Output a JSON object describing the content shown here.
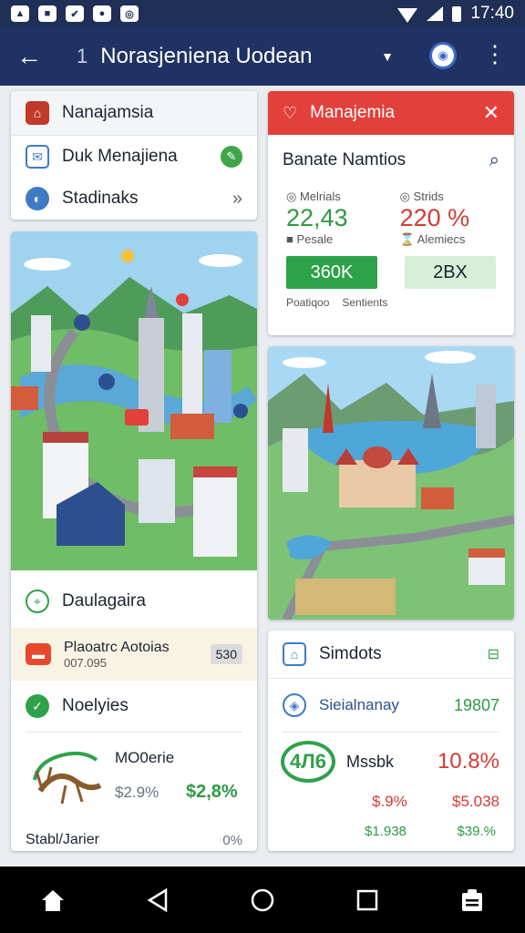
{
  "status": {
    "time": "17:40"
  },
  "appbar": {
    "number": "1",
    "title": "Norasjeniena Uodean"
  },
  "card1": {
    "header": "Nanajamsia",
    "items": [
      {
        "label": "Duk Menajiena"
      },
      {
        "label": "Stadinaks"
      }
    ]
  },
  "card2": {
    "header": "Manajemia",
    "title": "Banate Namtios",
    "metrics": [
      {
        "label": "Melrials",
        "value": "22,43",
        "sub": "Pesale"
      },
      {
        "label": "Strids",
        "value": "220 %",
        "sub": "Alemiecs"
      }
    ],
    "buttons": [
      "360K",
      "2BX"
    ],
    "footer": [
      "Poatiqoo",
      "Sentients"
    ]
  },
  "card3": {
    "section1": "Daulagaira",
    "notice": {
      "title": "Plaoatrc Aotoias",
      "value": "007.095",
      "badge": "530"
    },
    "section2": "Noelyies",
    "stat": {
      "title": "MO0erie",
      "left": "$2.9%",
      "right": "$2,8%"
    },
    "footer": {
      "label": "Stabl/Jarier",
      "value": "0%"
    }
  },
  "card5": {
    "header": "Simdots",
    "row": {
      "label": "Sieialnanay",
      "value": "19807"
    },
    "big": {
      "ring": "4Л6",
      "label": "Mssbk",
      "value": "10.8%"
    },
    "mid": [
      "$.9%",
      "$5.038"
    ],
    "bottom": [
      "$1.938",
      "$39.%"
    ]
  },
  "colors": {
    "green": "#2ea24a",
    "red": "#e2403a",
    "navy": "#1f3263"
  }
}
